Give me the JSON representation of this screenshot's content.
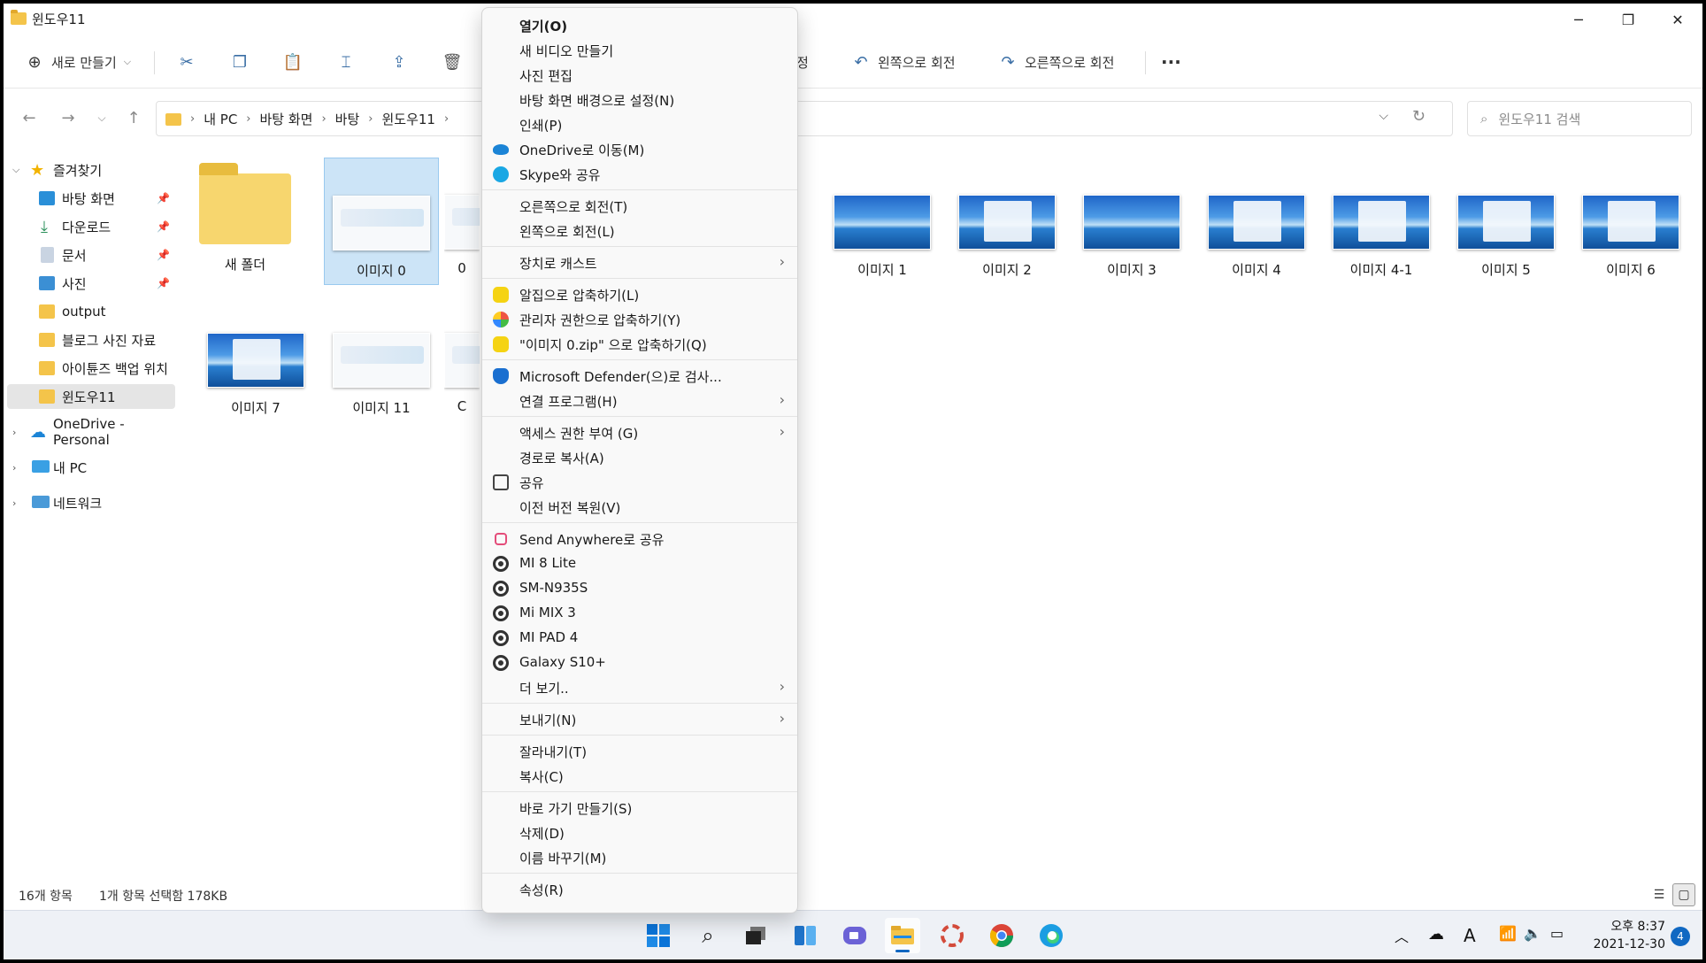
{
  "window": {
    "title": "윈도우11",
    "min": "─",
    "max": "❐",
    "close": "✕"
  },
  "commandbar": {
    "new_label": "새로 만들기",
    "new_chevron": "⌵",
    "partial_label": "정",
    "rotate_left": "왼쪽으로 회전",
    "rotate_right": "오른쪽으로 회전",
    "more": "···"
  },
  "address": {
    "crumbs": [
      "내 PC",
      "바탕 화면",
      "바탕",
      "윈도우11"
    ],
    "crumb_sep": "›",
    "search_placeholder": "윈도우11 검색"
  },
  "sidebar": {
    "quick_access": "즐겨찾기",
    "items": [
      "바탕 화면",
      "다운로드",
      "문서",
      "사진",
      "output",
      "블로그 사진 자료",
      "아이튠즈 백업 위치",
      "윈도우11"
    ],
    "onedrive": "OneDrive - Personal",
    "pc": "내 PC",
    "network": "네트워크"
  },
  "files": [
    {
      "name": "새 폴더",
      "kind": "folder"
    },
    {
      "name": "이미지 0",
      "kind": "white"
    },
    {
      "name": "이미지 1",
      "kind": "sea"
    },
    {
      "name": "이미지 2",
      "kind": "sea-win"
    },
    {
      "name": "이미지 3",
      "kind": "sea"
    },
    {
      "name": "이미지 4",
      "kind": "sea-win"
    },
    {
      "name": "이미지 4-1",
      "kind": "sea-win"
    },
    {
      "name": "이미지 5",
      "kind": "sea-win"
    },
    {
      "name": "이미지 6",
      "kind": "sea-win"
    },
    {
      "name": "이미지 7",
      "kind": "sea-win"
    },
    {
      "name": "이미지 11",
      "kind": "white"
    }
  ],
  "partial_tiles": [
    "0",
    "C"
  ],
  "status": {
    "count": "16개 항목",
    "selection": "1개 항목 선택함 178KB"
  },
  "clock": {
    "time": "오후 8:37",
    "date": "2021-12-30",
    "notifications": "4"
  },
  "tray": {
    "ime": "A"
  },
  "context_menu": {
    "groups": [
      [
        {
          "label": "열기(O)",
          "bold": true
        },
        {
          "label": "새 비디오 만들기"
        },
        {
          "label": "사진 편집"
        },
        {
          "label": "바탕 화면 배경으로 설정(N)"
        },
        {
          "label": "인쇄(P)"
        },
        {
          "label": "OneDrive로 이동(M)",
          "icon": "onedrive-icon"
        },
        {
          "label": "Skype와 공유",
          "icon": "skype-icon"
        }
      ],
      [
        {
          "label": "오른쪽으로 회전(T)"
        },
        {
          "label": "왼쪽으로 회전(L)"
        }
      ],
      [
        {
          "label": "장치로 캐스트",
          "submenu": true
        }
      ],
      [
        {
          "label": "알집으로 압축하기(L)",
          "icon": "alzip-icon"
        },
        {
          "label": "관리자 권한으로 압축하기(Y)",
          "icon": "alzip-admin-icon"
        },
        {
          "label": "\"이미지 0.zip\" 으로 압축하기(Q)",
          "icon": "alzip-icon"
        }
      ],
      [
        {
          "label": "Microsoft Defender(으)로 검사...",
          "icon": "defender-icon"
        },
        {
          "label": "연결 프로그램(H)",
          "submenu": true
        }
      ],
      [
        {
          "label": "액세스 권한 부여 (G)",
          "submenu": true
        },
        {
          "label": "경로로 복사(A)"
        },
        {
          "label": "공유",
          "icon": "share-icon"
        },
        {
          "label": "이전 버전 복원(V)"
        }
      ],
      [
        {
          "label": "Send Anywhere로 공유",
          "icon": "send-anywhere-icon"
        },
        {
          "label": "MI 8 Lite",
          "icon": "device-icon"
        },
        {
          "label": "SM-N935S",
          "icon": "device-icon"
        },
        {
          "label": "Mi MIX 3",
          "icon": "device-icon"
        },
        {
          "label": "MI PAD 4",
          "icon": "device-icon"
        },
        {
          "label": "Galaxy S10+",
          "icon": "device-icon"
        },
        {
          "label": "더 보기..",
          "submenu": true
        }
      ],
      [
        {
          "label": "보내기(N)",
          "submenu": true
        }
      ],
      [
        {
          "label": "잘라내기(T)"
        },
        {
          "label": "복사(C)"
        }
      ],
      [
        {
          "label": "바로 가기 만들기(S)"
        },
        {
          "label": "삭제(D)"
        },
        {
          "label": "이름 바꾸기(M)"
        }
      ],
      [
        {
          "label": "속성(R)"
        }
      ]
    ],
    "submenu_glyph": "›"
  },
  "colors": {
    "accent": "#1067c1",
    "selection": "#cce4f7",
    "folder": "#f4c44a"
  }
}
